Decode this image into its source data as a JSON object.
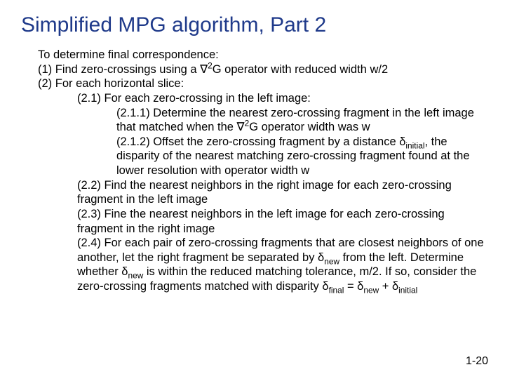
{
  "title": "Simplified MPG algorithm, Part 2",
  "intro": "To determine final correspondence:",
  "s1": "(1) Find zero-crossings using a ",
  "s1_op": "∇",
  "s1_sup": "2",
  "s1_tail": "G operator with reduced width w/2",
  "s2": "(2) For each horizontal slice:",
  "s21": "(2.1) For each zero-crossing in the left image:",
  "s211a": "(2.1.1) Determine the nearest zero-crossing fragment in the left image that matched when the ",
  "s211_op": "∇",
  "s211_sup": "2",
  "s211b": "G operator width was w",
  "s212a": "(2.1.2) Offset the zero-crossing fragment by a distance δ",
  "s212_sub1": "initial",
  "s212b": ", the disparity of the nearest matching zero-crossing fragment found at the lower resolution with operator width w",
  "s22": "(2.2) Find the nearest neighbors in the right image for each zero-crossing fragment in the left image",
  "s23": "(2.3) Fine the nearest neighbors in the left image for each zero-crossing fragment in the right image",
  "s24a": "(2.4) For each pair of zero-crossing fragments that are closest neighbors of one another, let the right fragment be separated by δ",
  "s24_sub1": "new",
  "s24b": " from the left. Determine whether δ",
  "s24_sub2": "new",
  "s24c": " is within the reduced matching tolerance, m/2. If so, consider the zero-crossing fragments matched with disparity δ",
  "s24_sub3": "final",
  "s24d": " = δ",
  "s24_sub4": "new",
  "s24e": " + δ",
  "s24_sub5": "initial",
  "page": "1-20"
}
